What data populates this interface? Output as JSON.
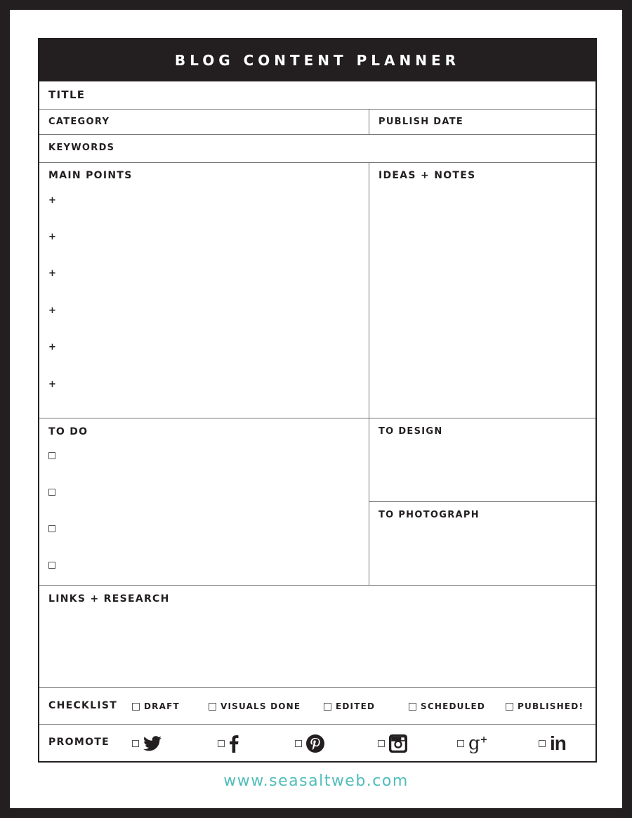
{
  "header": {
    "title": "BLOG CONTENT PLANNER"
  },
  "fields": {
    "title": "TITLE",
    "category": "CATEGORY",
    "publish_date": "PUBLISH DATE",
    "keywords": "KEYWORDS"
  },
  "main_points": {
    "label": "MAIN POINTS",
    "bullet": "+",
    "count": 6
  },
  "ideas_notes": {
    "label": "IDEAS + NOTES"
  },
  "todo": {
    "label": "TO DO",
    "count": 4
  },
  "to_design": {
    "label": "TO DESIGN"
  },
  "to_photograph": {
    "label": "TO PHOTOGRAPH"
  },
  "links_research": {
    "label": "LINKS + RESEARCH"
  },
  "checklist": {
    "label": "CHECKLIST",
    "items": [
      "DRAFT",
      "VISUALS DONE",
      "EDITED",
      "SCHEDULED",
      "PUBLISHED!"
    ]
  },
  "promote": {
    "label": "PROMOTE",
    "items": [
      "twitter-icon",
      "facebook-icon",
      "pinterest-icon",
      "instagram-icon",
      "google-plus-icon",
      "linkedin-icon"
    ]
  },
  "footer": {
    "url": "www.seasaltweb.com"
  },
  "colors": {
    "frame": "#231f20",
    "accent": "#4fbdb9"
  }
}
